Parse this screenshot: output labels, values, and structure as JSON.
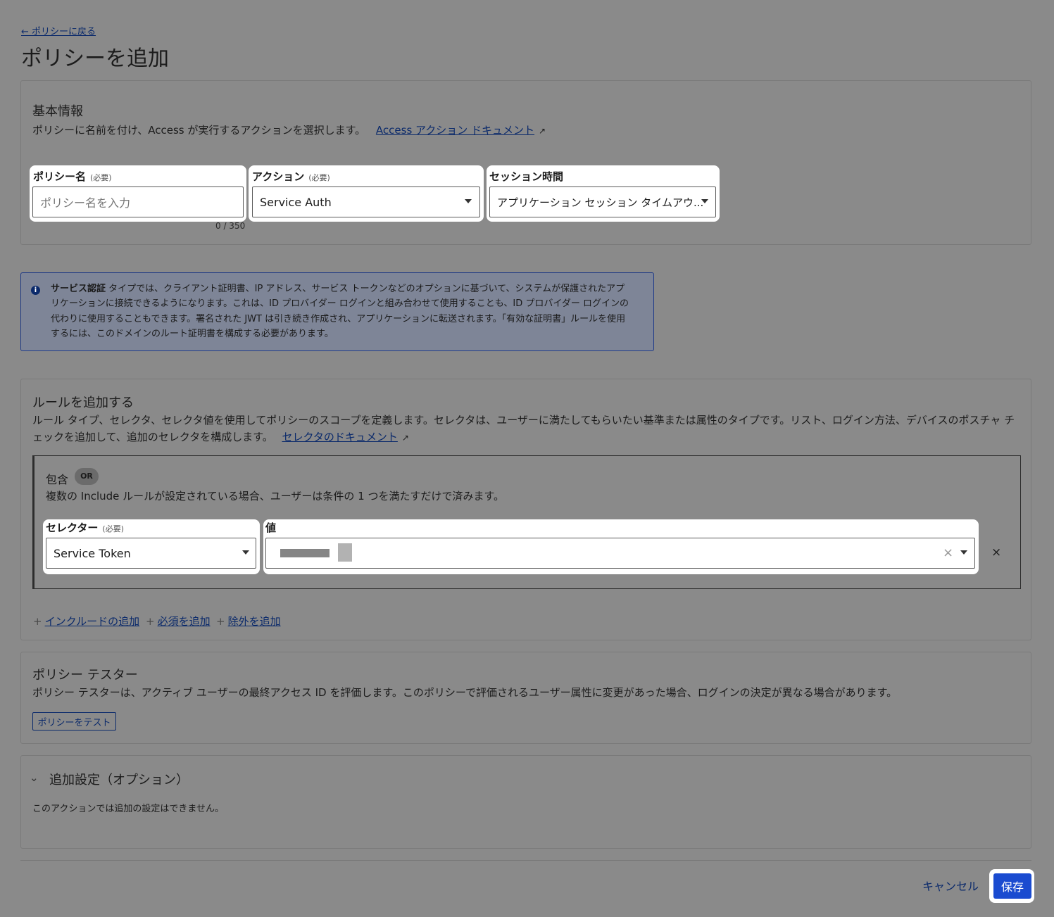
{
  "nav": {
    "back_label": "← ポリシーに戻る"
  },
  "page": {
    "title": "ポリシーを追加"
  },
  "basic": {
    "title": "基本情報",
    "desc": "ポリシーに名前を付け、Access が実行するアクションを選択します。",
    "doc_link": "Access アクション ドキュメント",
    "policy_name_label": "ポリシー名",
    "policy_name_required": "(必要)",
    "policy_name_placeholder": "ポリシー名を入力",
    "policy_name_counter": "0 / 350",
    "action_label": "アクション",
    "action_required": "(必要)",
    "action_value": "Service Auth",
    "session_label": "セッション時間",
    "session_value": "アプリケーション セッション タイムアウ..."
  },
  "info": {
    "bold": "サービス認証",
    "text": " タイプでは、クライアント証明書、IP アドレス、サービス トークンなどのオプションに基づいて、システムが保護されたアプリケーションに接続できるようになります。これは、ID プロバイダー ログインと組み合わせて使用することも、ID プロバイダー ログインの代わりに使用することもできます。署名された JWT は引き続き作成され、アプリケーションに転送されます。「有効な証明書」ルールを使用するには、このドメインのルート証明書を構成する必要があります。"
  },
  "rules": {
    "title": "ルールを追加する",
    "desc": "ルール タイプ、セレクタ、セレクタ値を使用してポリシーのスコープを定義します。セレクタは、ユーザーに満たしてもらいたい基準または属性のタイプです。リスト、ログイン方法、デバイスのポスチャ チェックを追加して、追加のセレクタを構成します。",
    "doc_link": "セレクタのドキュメント",
    "include_title": "包含",
    "or_badge": "OR",
    "include_desc": "複数の Include ルールが設定されている場合、ユーザーは条件の 1 つを満たすだけで済みます。",
    "selector_label": "セレクター",
    "selector_required": "(必要)",
    "selector_value": "Service Token",
    "value_label": "値",
    "clear_icon": "×",
    "remove_icon": "×",
    "add_include": "インクルードの追加",
    "add_require": "必須を追加",
    "add_exclude": "除外を追加",
    "plus": "+"
  },
  "tester": {
    "title": "ポリシー テスター",
    "desc": "ポリシー テスターは、アクティブ ユーザーの最終アクセス ID を評価します。このポリシーで評価されるユーザー属性に変更があった場合、ログインの決定が異なる場合があります。",
    "button": "ポリシーをテスト"
  },
  "additional": {
    "title": "追加設定（オプション）",
    "desc": "このアクションでは追加の設定はできません。"
  },
  "footer": {
    "cancel": "キャンセル",
    "save": "保存"
  },
  "icons": {
    "external": "external-link-icon",
    "info": "info-icon",
    "chevron": "chevron-down-icon",
    "caret": "caret-down-icon"
  },
  "colors": {
    "accent": "#1a4bd0",
    "link": "#0b2a6b",
    "overlay": "#8a8a8a"
  }
}
